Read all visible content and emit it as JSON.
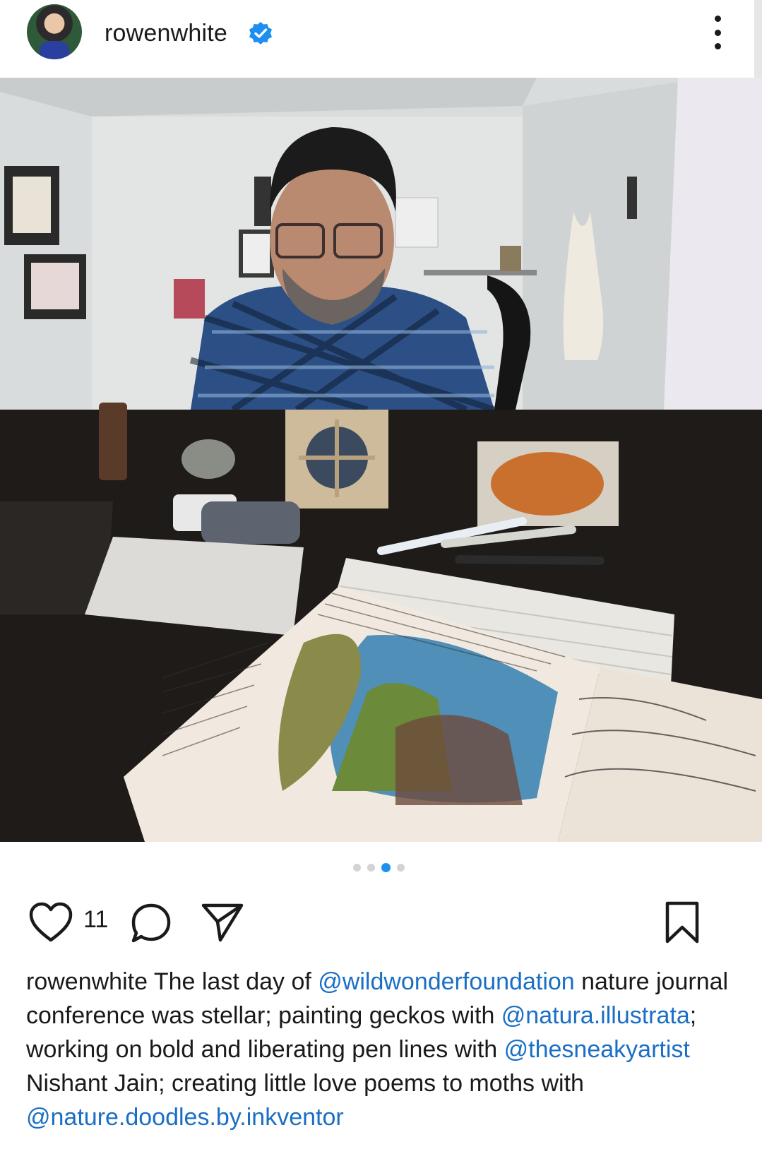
{
  "header": {
    "username": "rowenwhite",
    "verified_icon": "verified-badge-icon",
    "more_icon": "more-vertical-icon"
  },
  "post": {
    "image_description_icon": "photo",
    "carousel": {
      "count": 4,
      "active_index": 2
    }
  },
  "actions": {
    "like_icon": "heart-icon",
    "like_count": "11",
    "comment_icon": "comment-icon",
    "share_icon": "send-icon",
    "save_icon": "bookmark-icon"
  },
  "caption": {
    "username": "rowenwhite",
    "parts": [
      {
        "text": " The last day of ",
        "type": "text"
      },
      {
        "text": "@wildwonderfoundation",
        "type": "mention"
      },
      {
        "text": " nature journal conference was stellar; painting geckos with ",
        "type": "text"
      },
      {
        "text": "@natura.illustrata",
        "type": "mention"
      },
      {
        "text": "; working on bold and liberating pen lines with ",
        "type": "text"
      },
      {
        "text": "@thesneakyartist",
        "type": "mention"
      },
      {
        "text": " Nishant Jain;  creating little love poems to moths with ",
        "type": "text"
      },
      {
        "text": "@nature.doodles.by.inkventor",
        "type": "mention"
      }
    ]
  },
  "colors": {
    "mention": "#1a6fc4",
    "verified": "#1d8ff2",
    "active_dot": "#1d8ff2"
  }
}
